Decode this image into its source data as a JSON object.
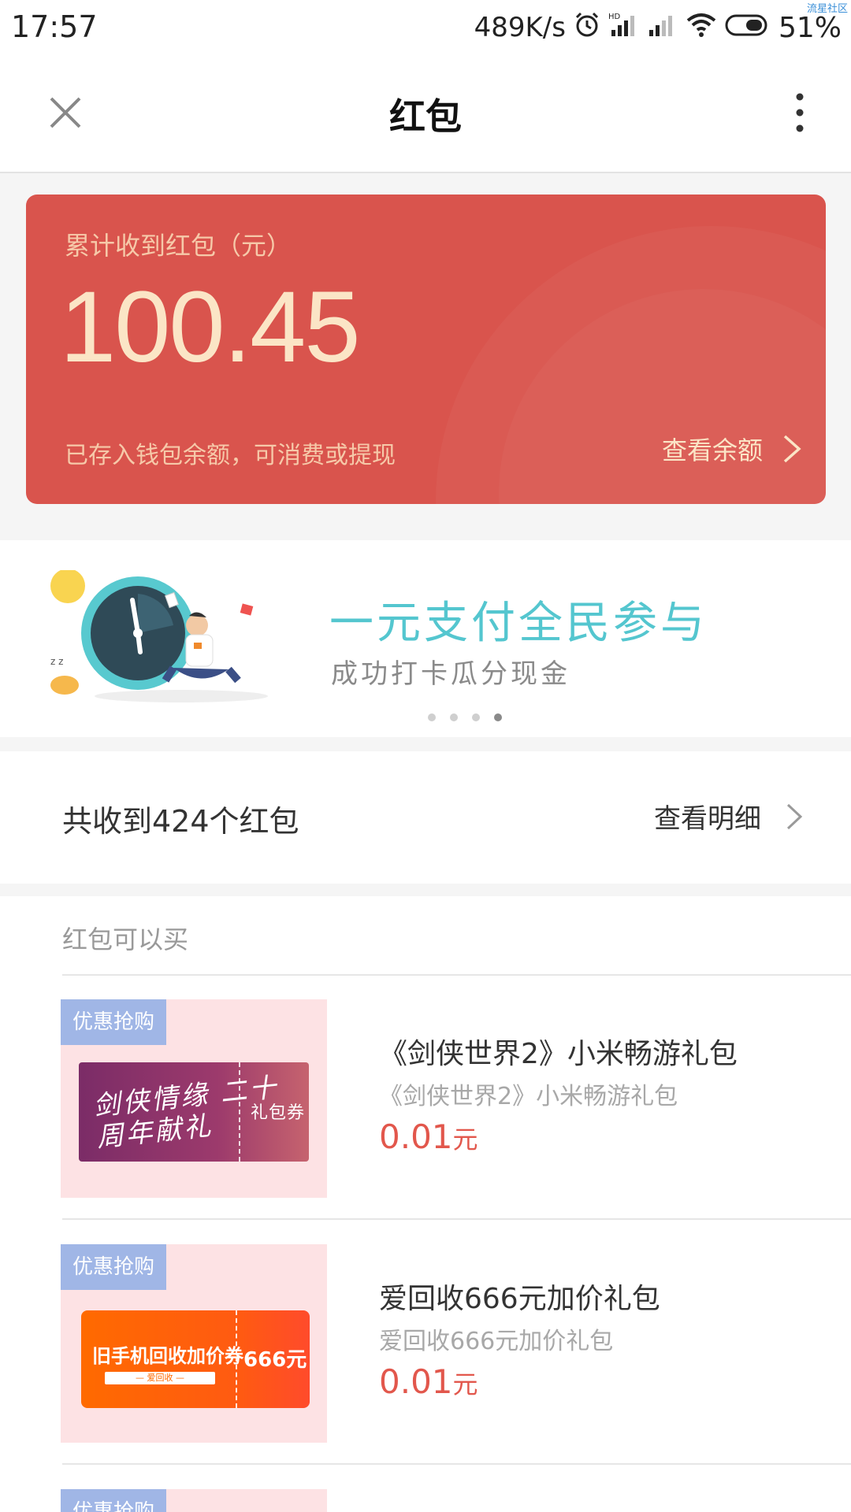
{
  "status_bar": {
    "time": "17:57",
    "net_speed": "489K/s",
    "battery": "51%",
    "corner_watermark": "流星社区"
  },
  "titlebar": {
    "title": "红包"
  },
  "red_card": {
    "label": "累计收到红包（元）",
    "amount": "100.45",
    "note": "已存入钱包余额，可消费或提现",
    "link": "查看余额",
    "color": "#d9544d"
  },
  "banner": {
    "title": "一元支付全民参与",
    "subtitle": "成功打卡瓜分现金",
    "slides": 4,
    "active_slide": 4
  },
  "summary": {
    "count_text": "共收到424个红包",
    "detail_link": "查看明细"
  },
  "buy_section": {
    "header": "红包可以买",
    "products": [
      {
        "tag": "优惠抢购",
        "name": "《剑侠世界2》小米畅游礼包",
        "desc": "《剑侠世界2》小米畅游礼包",
        "price": "0.01",
        "unit": "元",
        "coupon_script": "剑侠情缘 二十周年献礼",
        "coupon_label": "礼包券"
      },
      {
        "tag": "优惠抢购",
        "name": "爱回收666元加价礼包",
        "desc": "爱回收666元加价礼包",
        "price": "0.01",
        "unit": "元",
        "coupon_title": "旧手机回收加价券",
        "coupon_sub": "— 爱回收 —",
        "coupon_amount": "666元"
      }
    ],
    "partial_tag": "优惠抢购"
  },
  "colors": {
    "accent_red": "#e2574c",
    "card_red": "#d9544d",
    "banner_teal": "#54c6cf",
    "tag_blue": "#a0b6e6"
  }
}
